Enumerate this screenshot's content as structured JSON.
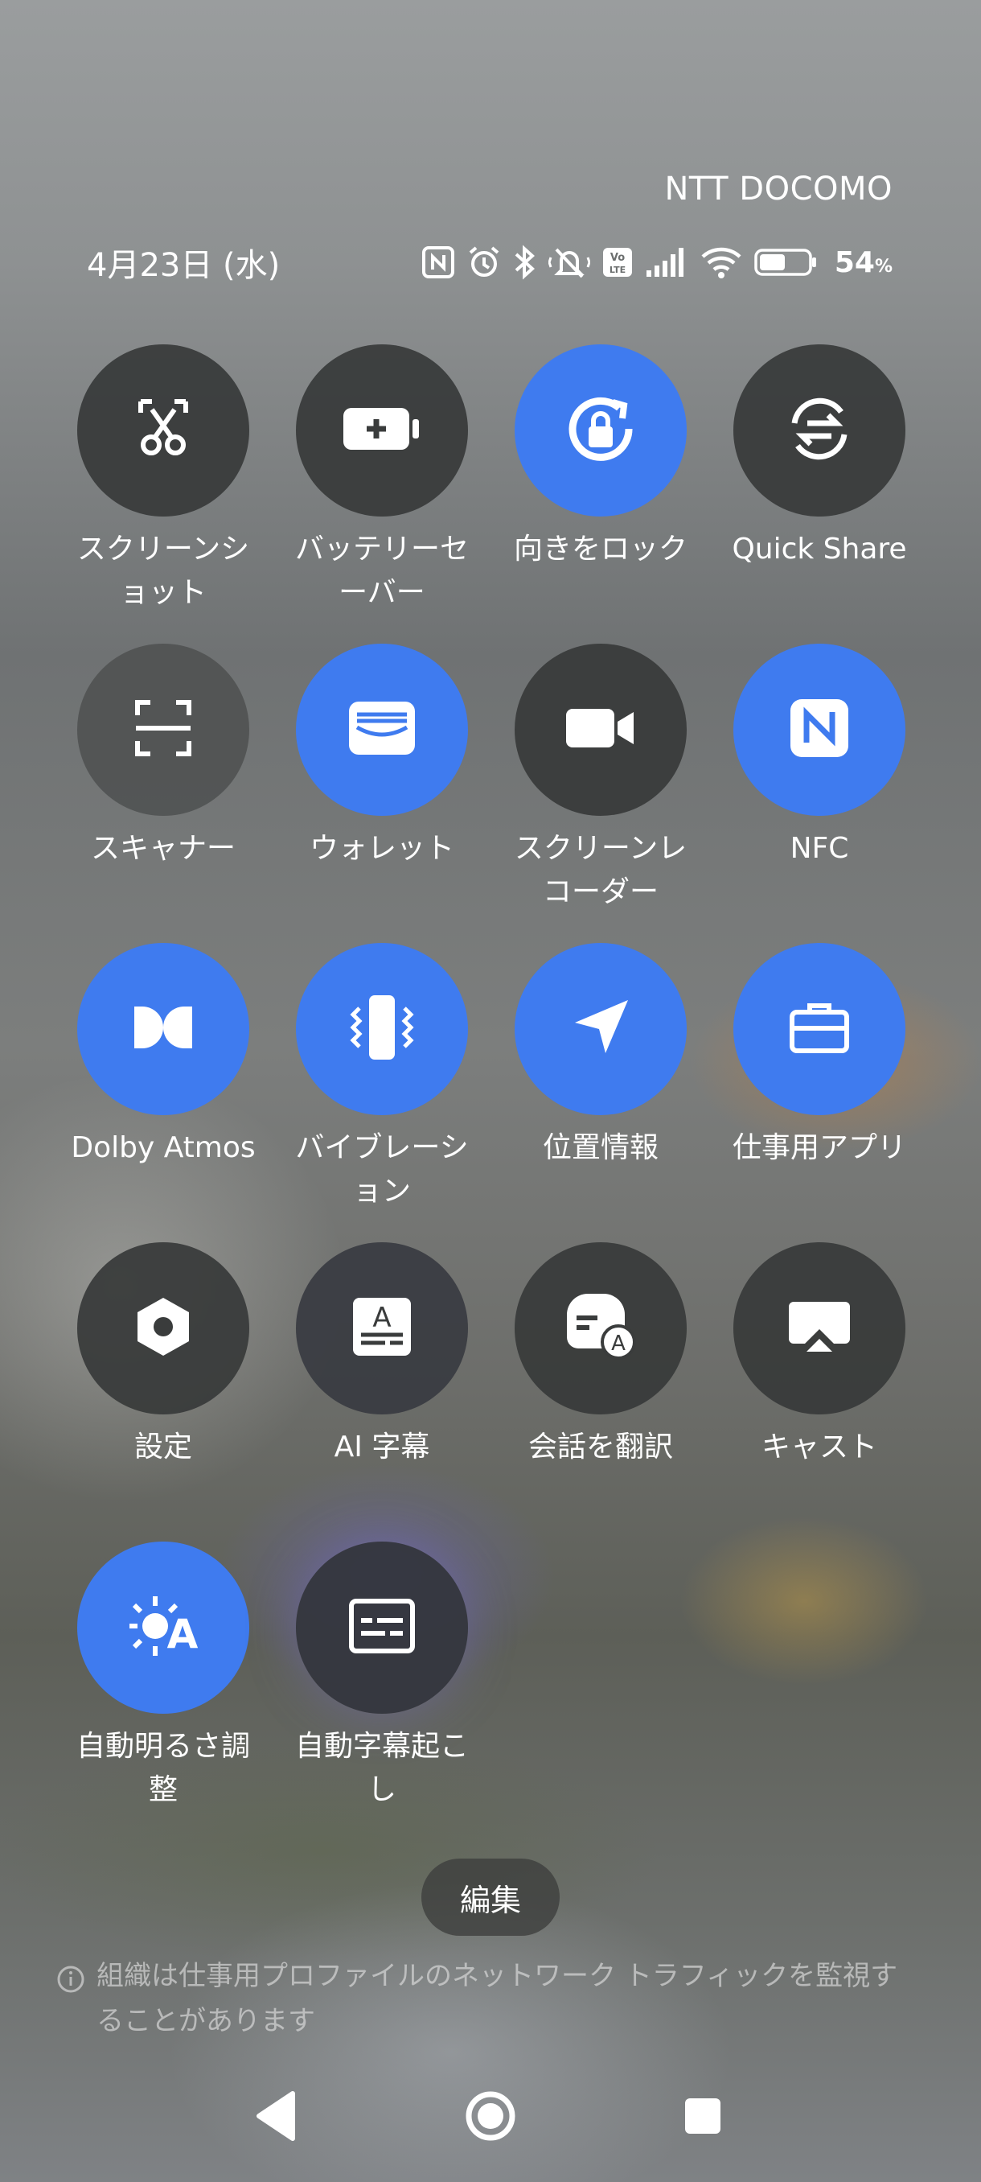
{
  "status_bar": {
    "carrier": "NTT DOCOMO",
    "date": "4月23日 (水)",
    "battery_percent": "54",
    "battery_percent_sign": "%",
    "battery_level": 0.54,
    "icons": [
      "nfc-icon",
      "alarm-icon",
      "bluetooth-icon",
      "silent-vibrate-icon",
      "volte-icon",
      "signal-icon",
      "wifi-icon",
      "battery-icon"
    ]
  },
  "tiles": [
    {
      "label": "スクリーンショット",
      "icon": "scissors-icon",
      "state": "off"
    },
    {
      "label": "バッテリーセーバー",
      "icon": "battery-saver-icon",
      "state": "off"
    },
    {
      "label": "向きをロック",
      "icon": "rotation-lock-icon",
      "state": "on"
    },
    {
      "label": "Quick Share",
      "icon": "quick-share-icon",
      "state": "off"
    },
    {
      "label": "スキャナー",
      "icon": "scanner-icon",
      "state": "off"
    },
    {
      "label": "ウォレット",
      "icon": "wallet-icon",
      "state": "on"
    },
    {
      "label": "スクリーンレコーダー",
      "icon": "video-camera-icon",
      "state": "off"
    },
    {
      "label": "NFC",
      "icon": "nfc-icon",
      "state": "on"
    },
    {
      "label": "Dolby Atmos",
      "icon": "dolby-icon",
      "state": "on"
    },
    {
      "label": "バイブレーション",
      "icon": "vibration-icon",
      "state": "on"
    },
    {
      "label": "位置情報",
      "icon": "location-arrow-icon",
      "state": "on"
    },
    {
      "label": "仕事用アプリ",
      "icon": "briefcase-icon",
      "state": "on"
    },
    {
      "label": "設定",
      "icon": "settings-hexagon-icon",
      "state": "off"
    },
    {
      "label": "AI 字幕",
      "icon": "ai-caption-icon",
      "state": "off"
    },
    {
      "label": "会話を翻訳",
      "icon": "translate-chat-icon",
      "state": "off"
    },
    {
      "label": "キャスト",
      "icon": "cast-icon",
      "state": "off"
    },
    {
      "label": "自動明るさ調整",
      "icon": "auto-brightness-icon",
      "state": "on"
    },
    {
      "label": "自動字幕起こし",
      "icon": "live-transcribe-icon",
      "state": "off"
    }
  ],
  "edit_button": {
    "label": "編集"
  },
  "notice": {
    "text": "組織は仕事用プロファイルのネットワーク トラフィックを監視することがあります",
    "icon": "info-icon"
  },
  "nav": {
    "back": "back-icon",
    "home": "home-icon",
    "recents": "recents-icon"
  },
  "colors": {
    "tile_on": "#3f7bef",
    "tile_off": "#373939",
    "text": "#ffffff"
  }
}
